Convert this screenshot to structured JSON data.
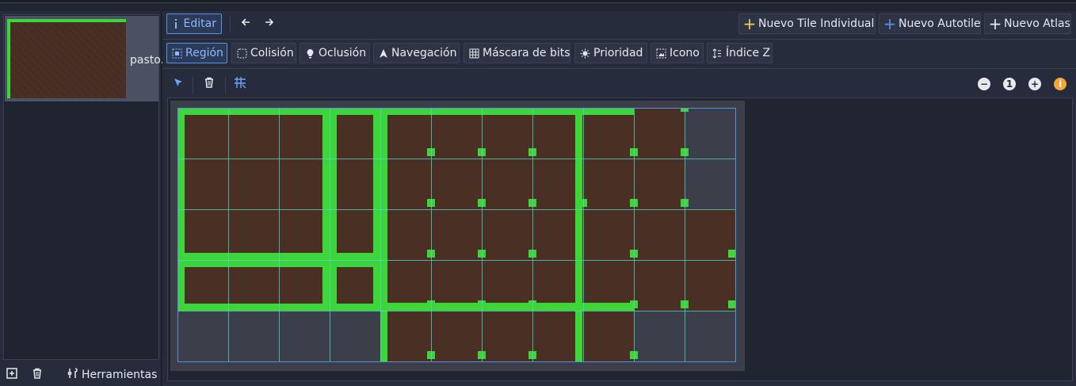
{
  "texture_panel": {
    "item_label": "pasto.",
    "tools_label": "Herramientas",
    "add_icon": "add-square-icon",
    "delete_icon": "trash-icon",
    "tools_icon": "wrench-icon"
  },
  "toolbar": {
    "edit_label": "Editar",
    "back_icon": "arrow-left-icon",
    "forward_icon": "arrow-right-icon",
    "new_single_tile": "Nuevo Tile Individual",
    "new_autotile": "Nuevo Autotile",
    "new_atlas": "Nuevo Atlas"
  },
  "modes": [
    {
      "label": "Región",
      "icon": "region-icon",
      "active": true
    },
    {
      "label": "Colisión",
      "icon": "collision-icon",
      "active": false
    },
    {
      "label": "Oclusión",
      "icon": "occlusion-icon",
      "active": false
    },
    {
      "label": "Navegación",
      "icon": "navigation-icon",
      "active": false
    },
    {
      "label": "Máscara de bits",
      "icon": "bitmask-icon",
      "active": false
    },
    {
      "label": "Prioridad",
      "icon": "priority-icon",
      "active": false
    },
    {
      "label": "Icono",
      "icon": "image-icon",
      "active": false
    },
    {
      "label": "Índice Z",
      "icon": "z-index-icon",
      "active": false
    }
  ],
  "subtools": {
    "select_icon": "pointer-icon",
    "delete_icon": "trash-icon",
    "grid_icon": "grid-icon",
    "zoom_out_icon": "zoom-out-icon",
    "zoom_reset_label": "1",
    "zoom_in_icon": "zoom-in-icon",
    "info_label": "i"
  },
  "colors": {
    "accent": "#5a8fe8",
    "grass": "#3dd63a",
    "dirt": "#4a2f25",
    "grid": "#4fd8c8",
    "warning": "#f7a43a"
  }
}
